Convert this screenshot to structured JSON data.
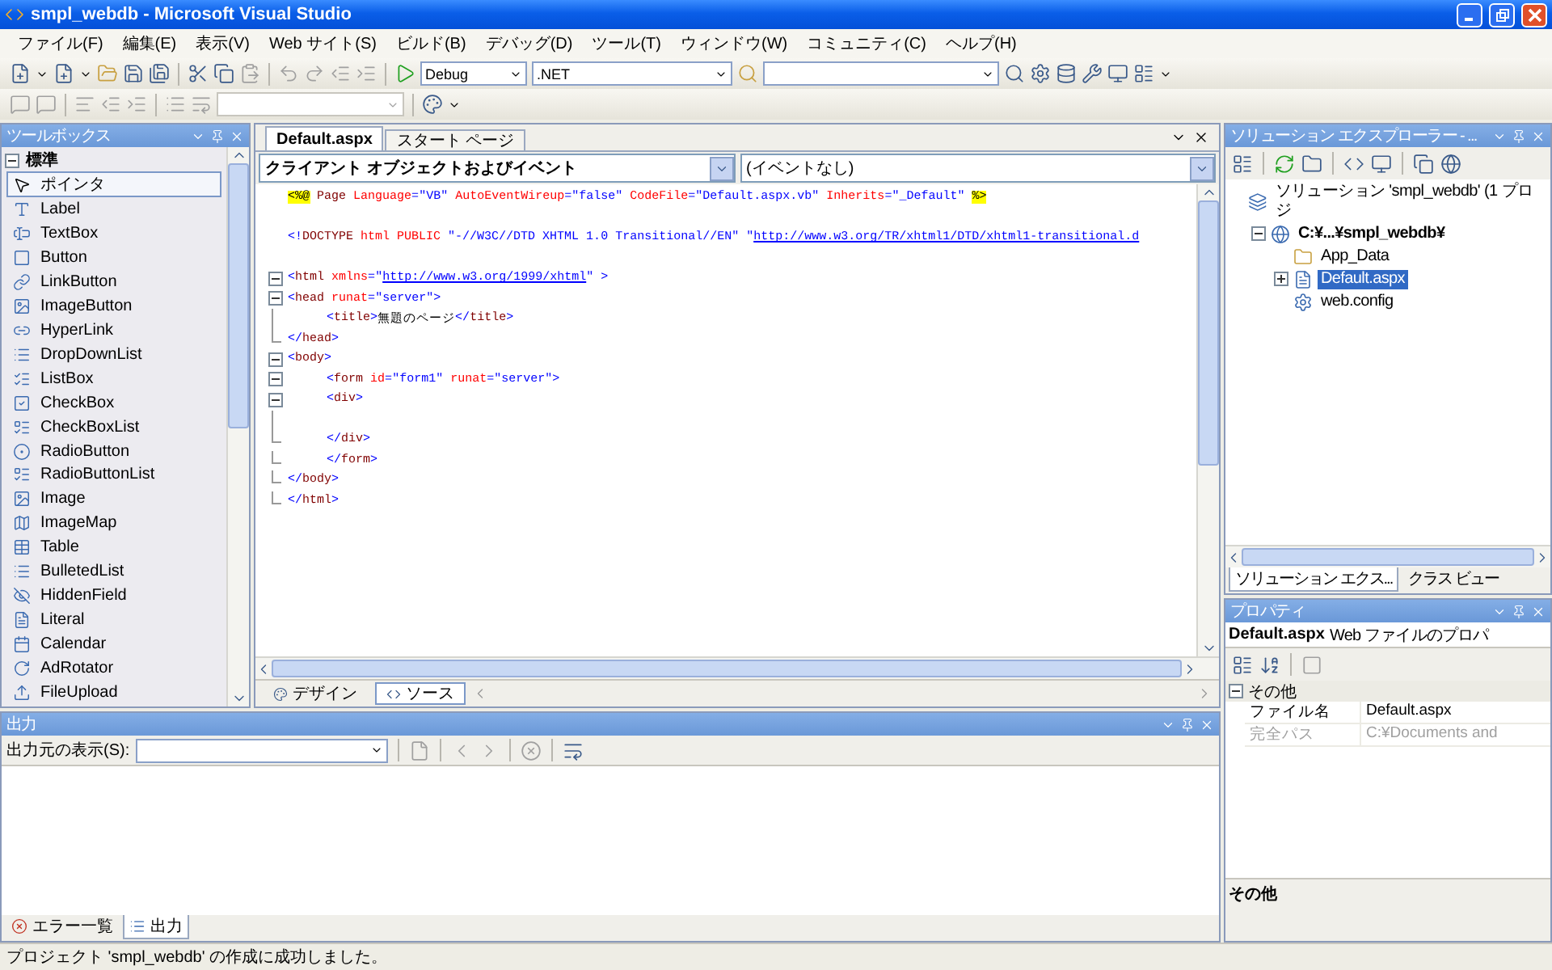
{
  "window": {
    "title": "smpl_webdb - Microsoft Visual Studio"
  },
  "menu": [
    "ファイル(F)",
    "編集(E)",
    "表示(V)",
    "Web サイト(S)",
    "ビルド(B)",
    "デバッグ(D)",
    "ツール(T)",
    "ウィンドウ(W)",
    "コミュニティ(C)",
    "ヘルプ(H)"
  ],
  "toolbar": {
    "configuration": "Debug",
    "platform": ".NET"
  },
  "toolbox": {
    "title": "ツールボックス",
    "group": {
      "label": "標準",
      "expanded": true,
      "items": [
        {
          "label": "ポインタ",
          "selected": true
        },
        {
          "label": "Label",
          "selected": false
        },
        {
          "label": "TextBox",
          "selected": false
        },
        {
          "label": "Button",
          "selected": false
        },
        {
          "label": "LinkButton",
          "selected": false
        },
        {
          "label": "ImageButton",
          "selected": false
        },
        {
          "label": "HyperLink",
          "selected": false
        },
        {
          "label": "DropDownList",
          "selected": false
        },
        {
          "label": "ListBox",
          "selected": false
        },
        {
          "label": "CheckBox",
          "selected": false
        },
        {
          "label": "CheckBoxList",
          "selected": false
        },
        {
          "label": "RadioButton",
          "selected": false
        },
        {
          "label": "RadioButtonList",
          "selected": false
        },
        {
          "label": "Image",
          "selected": false
        },
        {
          "label": "ImageMap",
          "selected": false
        },
        {
          "label": "Table",
          "selected": false
        },
        {
          "label": "BulletedList",
          "selected": false
        },
        {
          "label": "HiddenField",
          "selected": false
        },
        {
          "label": "Literal",
          "selected": false
        },
        {
          "label": "Calendar",
          "selected": false
        },
        {
          "label": "AdRotator",
          "selected": false
        },
        {
          "label": "FileUpload",
          "selected": false
        }
      ]
    }
  },
  "editor": {
    "tabs": [
      {
        "label": "Default.aspx",
        "selected": true
      },
      {
        "label": "スタート ページ",
        "selected": false
      }
    ],
    "object_dropdown": "クライアント オブジェクトおよびイベント",
    "event_dropdown": "(イベントなし)",
    "lines": [
      {
        "kind": "plain",
        "indented": false,
        "tokens": [
          {
            "kind": "directive",
            "text": "<%@"
          },
          {
            "kind": "tag",
            "text": " Page"
          },
          {
            "kind": "attr",
            "text": " Language"
          },
          {
            "kind": "delim",
            "text": "="
          },
          {
            "kind": "value",
            "text": "\"VB\""
          },
          {
            "kind": "attr",
            "text": " AutoEventWireup"
          },
          {
            "kind": "delim",
            "text": "="
          },
          {
            "kind": "value",
            "text": "\"false\""
          },
          {
            "kind": "attr",
            "text": " CodeFile"
          },
          {
            "kind": "delim",
            "text": "="
          },
          {
            "kind": "value",
            "text": "\"Default.aspx.vb\""
          },
          {
            "kind": "attr",
            "text": " Inherits"
          },
          {
            "kind": "delim",
            "text": "="
          },
          {
            "kind": "value",
            "text": "\"_Default\" "
          },
          {
            "kind": "directive",
            "text": "%>"
          }
        ]
      },
      {
        "kind": "plain"
      },
      {
        "kind": "plain",
        "indented": false,
        "tokens": [
          {
            "kind": "delim",
            "text": "<!"
          },
          {
            "kind": "tag",
            "text": "DOCTYPE"
          },
          {
            "kind": "attr",
            "text": " html PUBLIC"
          },
          {
            "kind": "value",
            "text": " \"-//W3C//DTD XHTML 1.0 Transitional//EN\" \""
          },
          {
            "kind": "link",
            "text": "http://www.w3.org/TR/xhtml1/DTD/xhtml1-transitional.d"
          }
        ]
      },
      {
        "kind": "plain"
      },
      {
        "kind": "fold_start",
        "indented": false,
        "tokens": [
          {
            "kind": "delim",
            "text": "<"
          },
          {
            "kind": "tag",
            "text": "html"
          },
          {
            "kind": "attr",
            "text": " xmlns"
          },
          {
            "kind": "delim",
            "text": "="
          },
          {
            "kind": "value",
            "text": "\""
          },
          {
            "kind": "link",
            "text": "http://www.w3.org/1999/xhtml"
          },
          {
            "kind": "value",
            "text": "\""
          },
          {
            "kind": "delim",
            "text": " >"
          }
        ]
      },
      {
        "kind": "fold_start",
        "indented": false,
        "tokens": [
          {
            "kind": "delim",
            "text": "<"
          },
          {
            "kind": "tag",
            "text": "head"
          },
          {
            "kind": "attr",
            "text": " runat"
          },
          {
            "kind": "delim",
            "text": "="
          },
          {
            "kind": "value",
            "text": "\"server\""
          },
          {
            "kind": "delim",
            "text": ">"
          }
        ]
      },
      {
        "kind": "fold_line",
        "indented": true,
        "tokens": [
          {
            "kind": "delim",
            "text": "<"
          },
          {
            "kind": "tag",
            "text": "title"
          },
          {
            "kind": "delim",
            "text": ">"
          },
          {
            "kind": "text",
            "text": "無題のページ"
          },
          {
            "kind": "delim",
            "text": "</"
          },
          {
            "kind": "tag",
            "text": "title"
          },
          {
            "kind": "delim",
            "text": ">"
          }
        ]
      },
      {
        "kind": "fold_end",
        "indented": false,
        "tokens": [
          {
            "kind": "delim",
            "text": "</"
          },
          {
            "kind": "tag",
            "text": "head"
          },
          {
            "kind": "delim",
            "text": ">"
          }
        ]
      },
      {
        "kind": "fold_start",
        "indented": false,
        "tokens": [
          {
            "kind": "delim",
            "text": "<"
          },
          {
            "kind": "tag",
            "text": "body"
          },
          {
            "kind": "delim",
            "text": ">"
          }
        ]
      },
      {
        "kind": "fold_start",
        "indented": true,
        "tokens": [
          {
            "kind": "delim",
            "text": "<"
          },
          {
            "kind": "tag",
            "text": "form"
          },
          {
            "kind": "attr",
            "text": " id"
          },
          {
            "kind": "delim",
            "text": "="
          },
          {
            "kind": "value",
            "text": "\"form1\""
          },
          {
            "kind": "attr",
            "text": " runat"
          },
          {
            "kind": "delim",
            "text": "="
          },
          {
            "kind": "value",
            "text": "\"server\""
          },
          {
            "kind": "delim",
            "text": ">"
          }
        ]
      },
      {
        "kind": "fold_start",
        "indented": true,
        "tokens": [
          {
            "kind": "delim",
            "text": "<"
          },
          {
            "kind": "tag",
            "text": "div"
          },
          {
            "kind": "delim",
            "text": ">"
          }
        ]
      },
      {
        "kind": "fold_line"
      },
      {
        "kind": "fold_end",
        "indented": true,
        "tokens": [
          {
            "kind": "delim",
            "text": "</"
          },
          {
            "kind": "tag",
            "text": "div"
          },
          {
            "kind": "delim",
            "text": ">"
          }
        ]
      },
      {
        "kind": "fold_end",
        "indented": true,
        "tokens": [
          {
            "kind": "delim",
            "text": "</"
          },
          {
            "kind": "tag",
            "text": "form"
          },
          {
            "kind": "delim",
            "text": ">"
          }
        ]
      },
      {
        "kind": "fold_end",
        "indented": false,
        "tokens": [
          {
            "kind": "delim",
            "text": "</"
          },
          {
            "kind": "tag",
            "text": "body"
          },
          {
            "kind": "delim",
            "text": ">"
          }
        ]
      },
      {
        "kind": "fold_end",
        "indented": false,
        "tokens": [
          {
            "kind": "delim",
            "text": "</"
          },
          {
            "kind": "tag",
            "text": "html"
          },
          {
            "kind": "delim",
            "text": ">"
          }
        ]
      }
    ],
    "view_tabs": [
      {
        "label": "デザイン",
        "selected": false
      },
      {
        "label": "ソース",
        "selected": true
      }
    ]
  },
  "solution_explorer": {
    "title": "ソリューション エクスプローラー - ...",
    "tree": [
      {
        "label": "ソリューション 'smpl_webdb' (1 プロジ",
        "kind": "solution",
        "startup": false,
        "selected": false,
        "children": [
          {
            "label": "C:¥...¥smpl_webdb¥",
            "kind": "project",
            "startup": true,
            "selected": false,
            "expanded": true,
            "children": [
              {
                "label": "App_Data",
                "kind": "folder",
                "startup": false,
                "selected": false
              },
              {
                "label": "Default.aspx",
                "kind": "page",
                "startup": false,
                "selected": true,
                "expanded": false
              },
              {
                "label": "web.config",
                "kind": "config",
                "startup": false,
                "selected": false
              }
            ]
          }
        ]
      }
    ],
    "tabs": [
      {
        "label": "ソリューション エクス...",
        "selected": true
      },
      {
        "label": "クラス ビュー",
        "selected": false
      }
    ]
  },
  "properties": {
    "title": "プロパティ",
    "object": "Default.aspx",
    "object_type": "Web ファイルのプロパ",
    "category": {
      "label": "その他",
      "expanded": true,
      "rows": [
        {
          "name": "ファイル名",
          "value": "Default.aspx",
          "disabled": false
        },
        {
          "name": "完全パス",
          "value": "C:¥Documents and",
          "disabled": true
        }
      ]
    },
    "description": "その他"
  },
  "output": {
    "title": "出力",
    "source_label": "出力元の表示(S):"
  },
  "bottom_tabs": [
    {
      "label": "エラー一覧",
      "selected": false
    },
    {
      "label": "出力",
      "selected": true
    }
  ],
  "status_bar": "プロジェクト 'smpl_webdb' の作成に成功しました。"
}
